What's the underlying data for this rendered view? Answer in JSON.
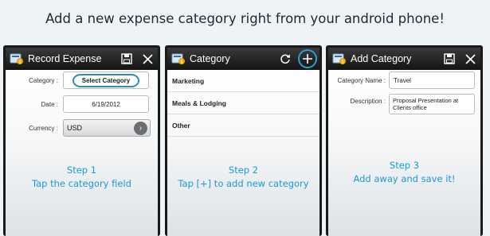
{
  "headline": "Add a new expense category right from your android phone!",
  "colors": {
    "accent": "#1a9ad6",
    "highlight_ring": "#2a9fd8",
    "titlebar": "#1a1a1a"
  },
  "screen1": {
    "title": "Record Expense",
    "icons": [
      "app-icon",
      "save-icon",
      "close-icon"
    ],
    "category_label": "Category :",
    "category_value": "Select Category",
    "date_label": "Date :",
    "date_value": "6/19/2012",
    "currency_label": "Currency :",
    "currency_value": "USD",
    "step_title": "Step 1",
    "step_text": "Tap the category field"
  },
  "screen2": {
    "title": "Category",
    "icons": [
      "app-icon",
      "refresh-icon",
      "add-icon"
    ],
    "items": [
      "Marketing",
      "Meals & Lodging",
      "Other"
    ],
    "step_title": "Step 2",
    "step_text": "Tap [+] to add new category"
  },
  "screen3": {
    "title": "Add Category",
    "icons": [
      "app-icon",
      "save-icon",
      "close-icon"
    ],
    "name_label": "Category Name :",
    "name_value": "Travel",
    "desc_label": "Description :",
    "desc_value": "Proposal Presentation at Clients office",
    "step_title": "Step 3",
    "step_text": "Add away and save it!"
  }
}
